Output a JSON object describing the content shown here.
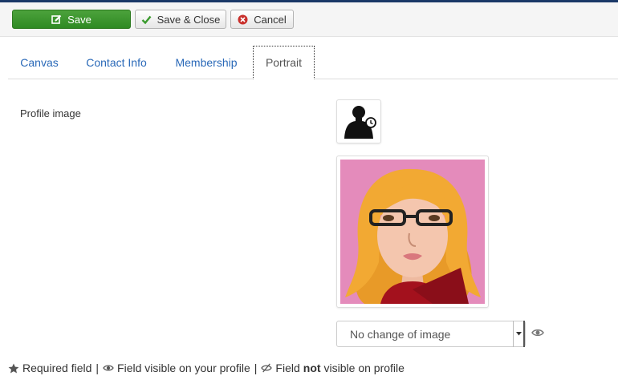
{
  "toolbar": {
    "save_label": "Save",
    "save_close_label": "Save & Close",
    "cancel_label": "Cancel",
    "save_icon": "edit-icon",
    "save_close_icon": "check-icon",
    "cancel_icon": "cancel-circle-icon"
  },
  "tabs": [
    {
      "label": "Canvas",
      "active": false
    },
    {
      "label": "Contact Info",
      "active": false
    },
    {
      "label": "Membership",
      "active": false
    },
    {
      "label": "Portrait",
      "active": true
    }
  ],
  "portrait": {
    "field_label": "Profile image",
    "thumbnail_icon": "user-pending-icon",
    "image_select": {
      "selected": "No change of image"
    },
    "visibility_icon": "eye-icon"
  },
  "legend": {
    "required": "Required field",
    "separator": "|",
    "visible": "Field visible on your profile",
    "not_prefix": "Field",
    "not_word": "not",
    "not_suffix": "visible on profile"
  },
  "colors": {
    "save_green": "#2f8a23",
    "link_blue": "#2a69b8",
    "avatar_background": "#e48bbb"
  }
}
